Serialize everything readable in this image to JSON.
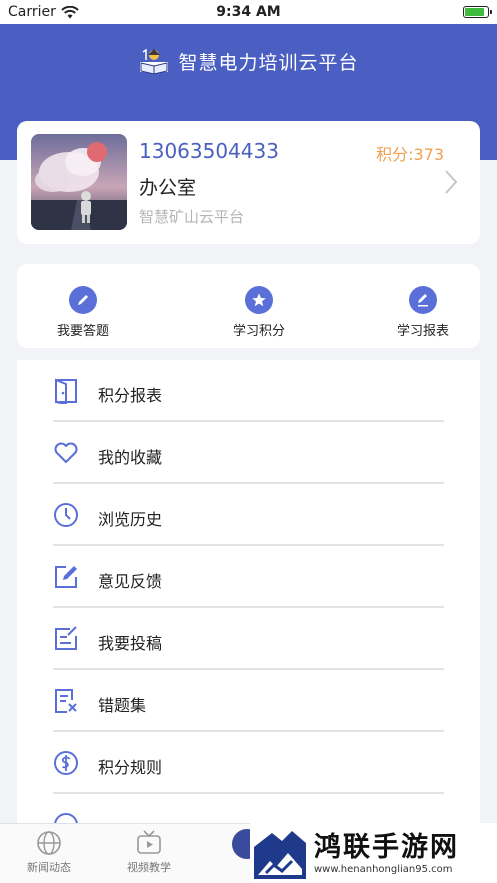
{
  "status_bar": {
    "carrier": "Carrier",
    "time": "9:34 AM",
    "battery_level": 0.85
  },
  "header": {
    "title": "智慧电力培训云平台"
  },
  "profile": {
    "phone": "13063504433",
    "points": "积分:373",
    "department": "办公室",
    "organization": "智慧矿山云平台"
  },
  "quick_actions": [
    {
      "label": "我要答题",
      "icon": "pencil-icon"
    },
    {
      "label": "学习积分",
      "icon": "star-icon"
    },
    {
      "label": "学习报表",
      "icon": "edit-icon"
    }
  ],
  "menu": [
    {
      "label": "积分报表",
      "icon": "door-exit-icon"
    },
    {
      "label": "我的收藏",
      "icon": "heart-icon"
    },
    {
      "label": "浏览历史",
      "icon": "clock-icon"
    },
    {
      "label": "意见反馈",
      "icon": "edit-square-icon"
    },
    {
      "label": "我要投稿",
      "icon": "compose-icon"
    },
    {
      "label": "错题集",
      "icon": "document-x-icon"
    },
    {
      "label": "积分规则",
      "icon": "dollar-circle-icon"
    }
  ],
  "tabbar": [
    {
      "label": "新闻动态",
      "icon": "globe-icon"
    },
    {
      "label": "视频教学",
      "icon": "tv-play-icon"
    }
  ],
  "watermark": {
    "title": "鸿联手游网",
    "url": "www.henanhonglian95.com"
  },
  "colors": {
    "primary": "#4a5fc1",
    "points": "#f0a050",
    "icon_fill": "#5a70d8"
  }
}
